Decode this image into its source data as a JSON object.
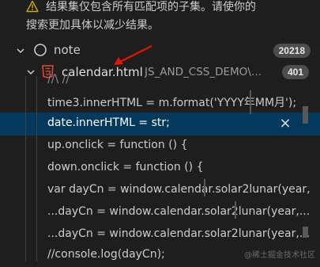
{
  "warning": {
    "icon": "warning-triangle-icon",
    "line1": "结果集仅包含所有匹配项的子集。请使你的",
    "line2": "搜索更加具体以减少结果。"
  },
  "tree": {
    "folder": {
      "icon": "circle-outline-icon",
      "label": "note",
      "count": "20218"
    },
    "file": {
      "icon": "html5-icon",
      "name": "calendar.html",
      "path": "JS_AND_CSS_DEMO\\F...",
      "count": "401"
    }
  },
  "matches": [
    "//\\ //",
    "time3.innerHTML = m.format('YYYY年MM月');",
    "date.innerHTML = str;",
    "up.onclick = function () {",
    "down.onclick = function () {",
    "var dayCn = window.calendar.solar2lunar(year,",
    "...dayCn = window.calendar.solar2lunar(year,...",
    "...dayCn = window.calendar.solar2lunar(year,...",
    "//console.log(dayCn);"
  ],
  "selected_match": 2,
  "close_label": "×",
  "watermark": "@稀土掘金技术社区",
  "colors": {
    "background": "#1e1e1e",
    "selection": "#04395e",
    "badge": "#4d4d4d",
    "html_icon": "#e44d26",
    "warning": "#cca700",
    "annotation_arrow": "#e51400"
  }
}
